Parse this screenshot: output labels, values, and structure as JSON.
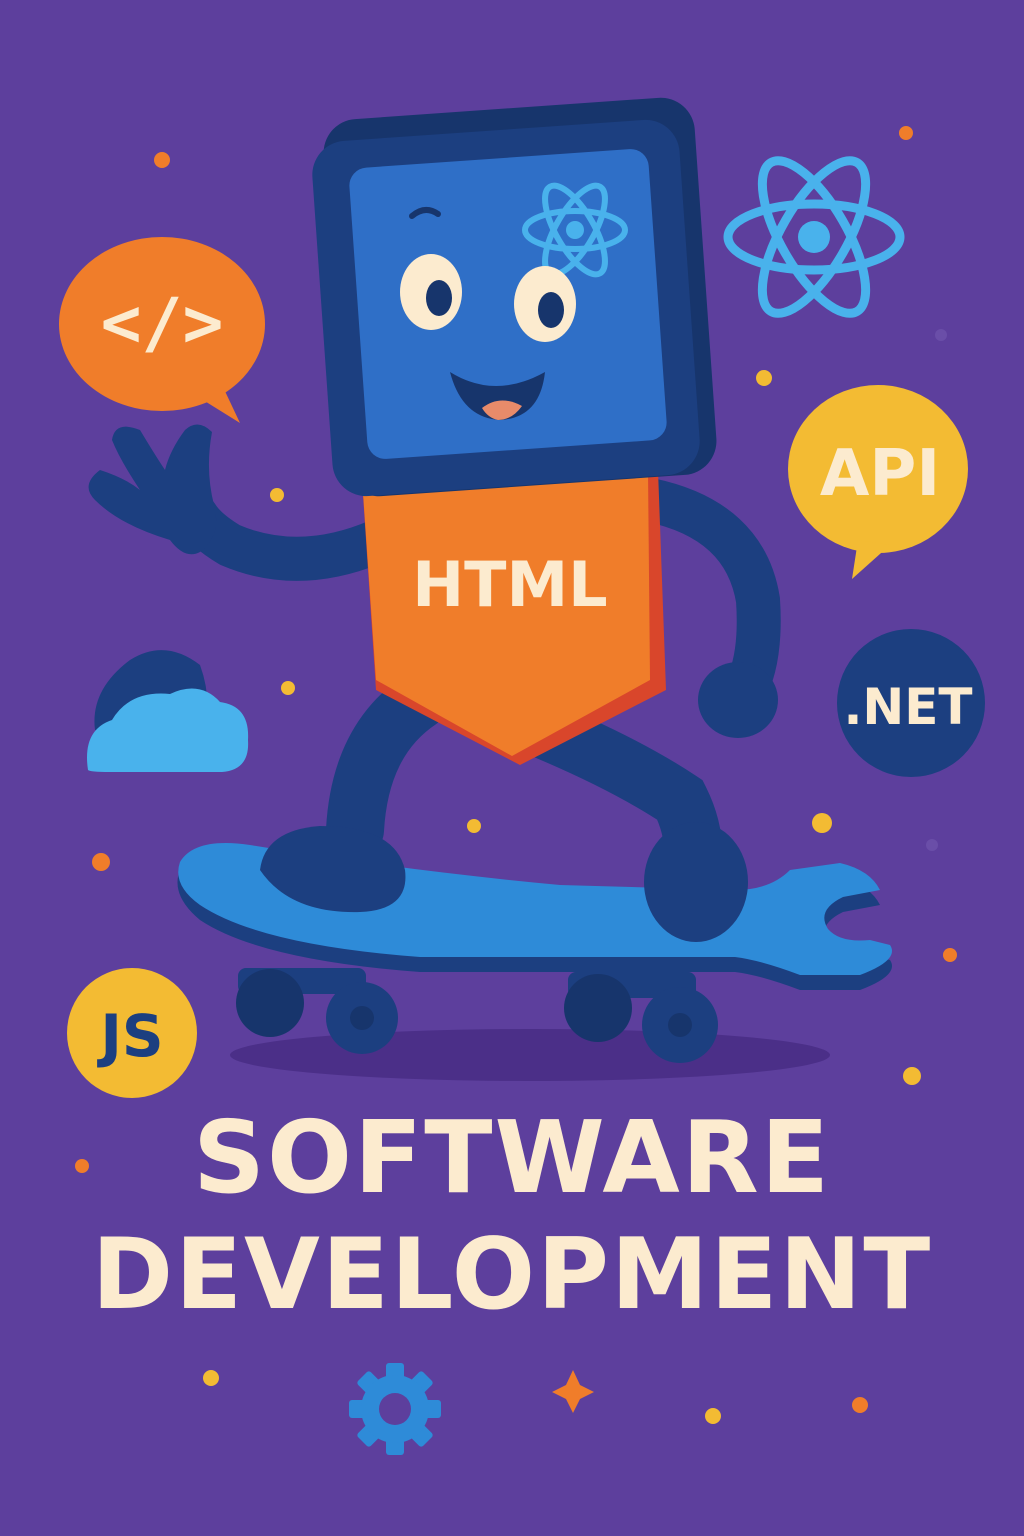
{
  "poster": {
    "title_line1": "SOFTWARE",
    "title_line2": "DEVELOPMENT"
  },
  "badges": {
    "code_bubble": "</>",
    "api_bubble": "API",
    "dotnet_circle": ".NET",
    "js_circle": "JS",
    "shirt_label": "HTML"
  },
  "colors": {
    "background": "#5d3f9d",
    "title_text": "#fcebcf",
    "orange": "#f07d2a",
    "yellow": "#f3bb33",
    "navy": "#1c3f80",
    "blue": "#2f6fc7",
    "light_blue": "#49b2ec",
    "cream": "#fcebcf"
  },
  "icons": [
    "code-bubble-icon",
    "react-atom-icon",
    "api-bubble-icon",
    "dotnet-badge-icon",
    "js-badge-icon",
    "cloud-icon",
    "gear-icon",
    "sparkle-icon",
    "wrench-skateboard"
  ]
}
